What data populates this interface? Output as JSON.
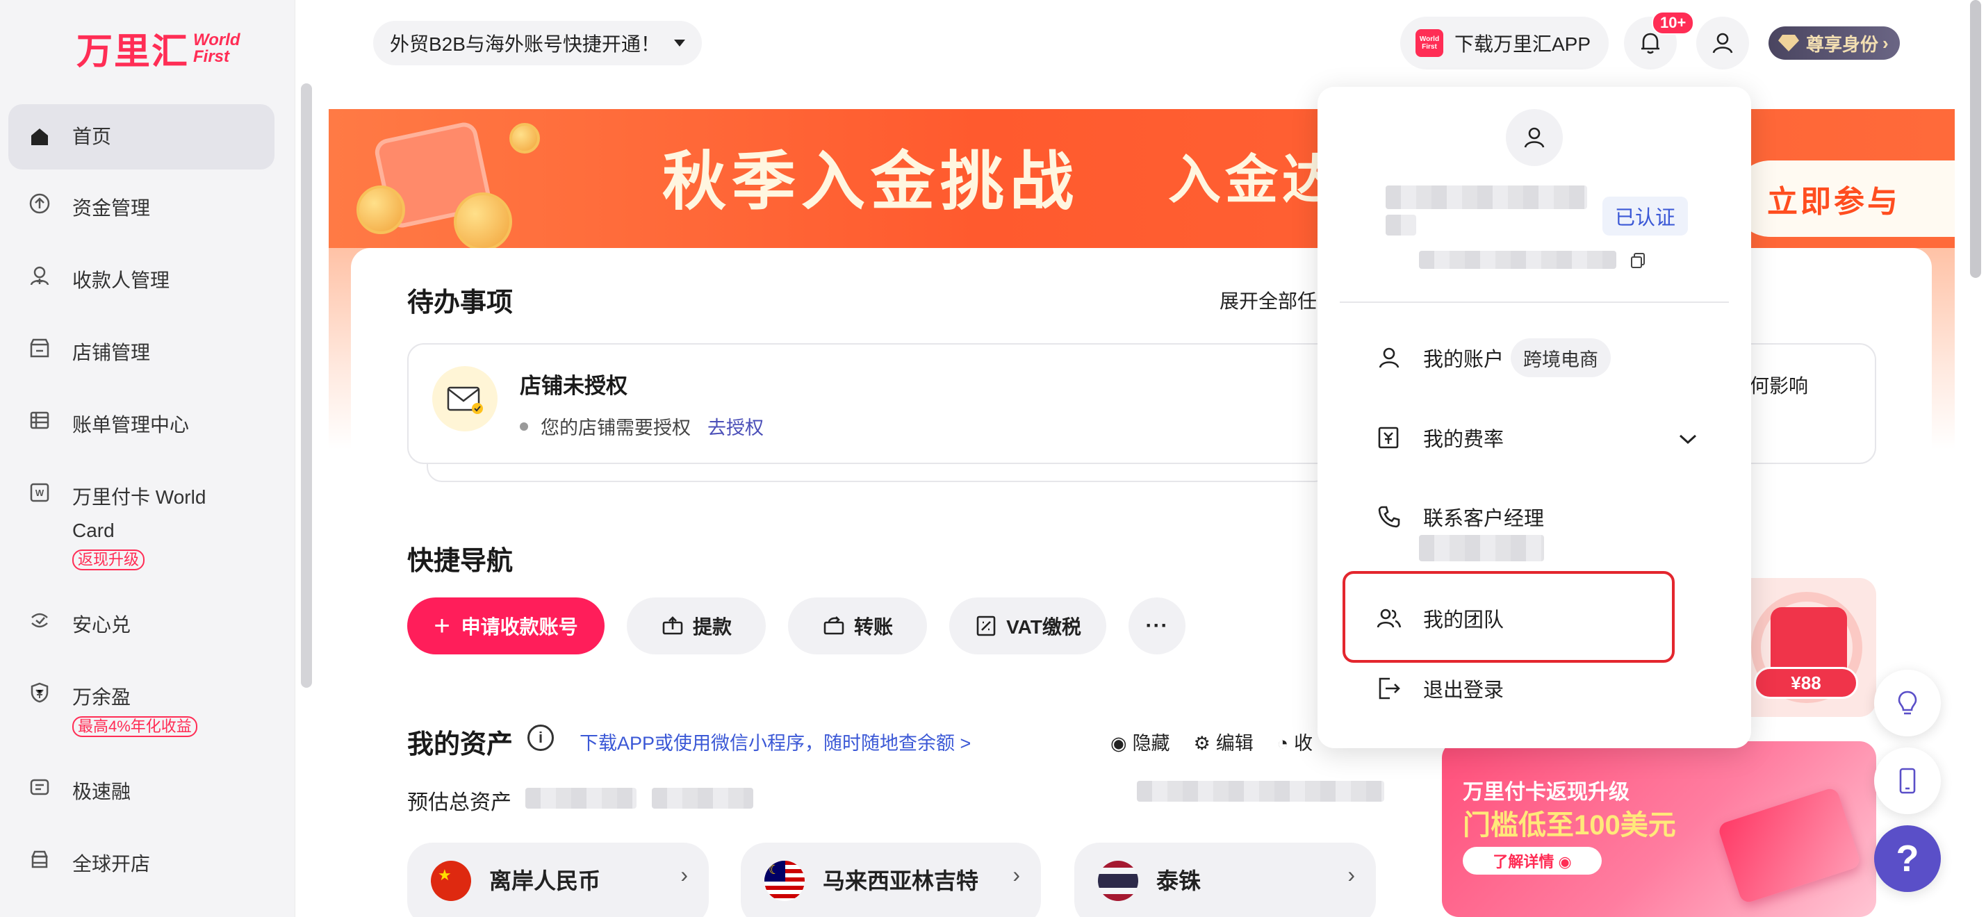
{
  "brand": {
    "name_cn": "万里汇",
    "name_en_1": "World",
    "name_en_2": "First",
    "accent": "#ff2d55"
  },
  "sidebar": {
    "items": [
      {
        "label": "首页",
        "icon": "home-icon",
        "active": true
      },
      {
        "label": "资金管理",
        "icon": "upload-circle-icon"
      },
      {
        "label": "收款人管理",
        "icon": "user-add-icon"
      },
      {
        "label": "店铺管理",
        "icon": "store-icon"
      },
      {
        "label": "账单管理中心",
        "icon": "bill-list-icon"
      },
      {
        "label": "万里付卡 World",
        "label2": "Card",
        "icon": "card-w-icon",
        "badge": "返现升级"
      },
      {
        "label": "安心兑",
        "icon": "exchange-icon"
      },
      {
        "label": "万余盈",
        "icon": "shield-yen-icon",
        "badge": "最高4%年化收益"
      },
      {
        "label": "极速融",
        "icon": "finance-icon"
      },
      {
        "label": "全球开店",
        "icon": "shop-globe-icon"
      }
    ]
  },
  "topbar": {
    "promo_select": "外贸B2B与海外账号快捷开通！",
    "download_app": "下载万里汇APP",
    "mini_logo_1": "World",
    "mini_logo_2": "First",
    "notif_count": "10+",
    "vip_label": "尊享身份",
    "vip_arrow": "›"
  },
  "banner": {
    "title": "秋季入金挑战",
    "subtitle": "入金达标",
    "cta": "立即参与"
  },
  "todo": {
    "title": "待办事项",
    "expand_all": "展开全部任",
    "item_title": "店铺未授权",
    "item_desc": "您的店铺需要授权",
    "item_link": "去授权",
    "item_right": "任何影响"
  },
  "quick_nav": {
    "title": "快捷导航",
    "buttons": [
      {
        "label": "申请收款账号",
        "icon": "plus-icon",
        "plus": "+"
      },
      {
        "label": "提款",
        "icon": "withdraw-icon"
      },
      {
        "label": "转账",
        "icon": "transfer-icon"
      },
      {
        "label": "VAT缴税",
        "icon": "tax-icon"
      },
      {
        "label": "···",
        "icon": "more-icon"
      }
    ]
  },
  "assets": {
    "title": "我的资产",
    "info": "i",
    "link": "下载APP或使用微信小程序，随时随地查余额 >",
    "tools": {
      "hide": "隐藏",
      "edit": "编辑",
      "collapse": "收"
    },
    "estimate_label": "预估总资产",
    "currencies": [
      {
        "label": "离岸人民币",
        "flag": "cn-flag",
        "arrow": "›"
      },
      {
        "label": "马来西亚林吉特",
        "flag": "my-flag",
        "arrow": "›"
      },
      {
        "label": "泰铢",
        "flag": "th-flag",
        "arrow": "›"
      }
    ]
  },
  "promos": {
    "redpacket_amount": "¥88",
    "card_title": "万里付卡返现升级",
    "card_big": "门槛低至100美元",
    "card_btn": "了解详情 ◉"
  },
  "floating": {
    "help": "?"
  },
  "dropdown": {
    "verified": "已认证",
    "items": [
      {
        "label": "我的账户",
        "tag": "跨境电商",
        "icon": "user-icon"
      },
      {
        "label": "我的费率",
        "icon": "rate-icon",
        "expand": true
      },
      {
        "label": "联系客户经理",
        "icon": "phone-icon"
      },
      {
        "label": "我的团队",
        "icon": "team-icon",
        "highlighted": true
      },
      {
        "label": "退出登录",
        "icon": "logout-icon"
      }
    ]
  }
}
